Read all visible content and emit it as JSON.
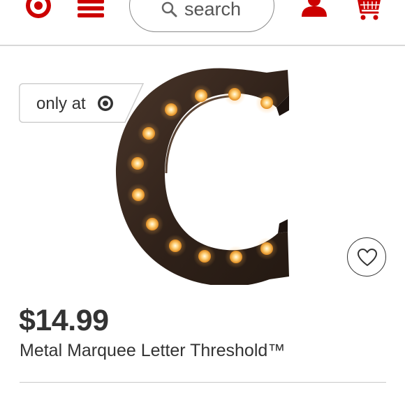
{
  "header": {
    "search": {
      "placeholder": "search"
    },
    "icons": {
      "logo": "target-bullseye-icon",
      "menu": "hamburger-menu-icon",
      "search": "magnifier-icon",
      "account": "person-icon",
      "cart": "cart-icon"
    }
  },
  "badge": {
    "text": "only at",
    "icon": "target-bullseye-icon"
  },
  "product": {
    "image": "marquee-letter-c-image",
    "price": "$14.99",
    "title": "Metal Marquee Letter Threshold™",
    "favorite_icon": "heart-icon"
  },
  "colors": {
    "brand": "#cc0000",
    "text": "#333333",
    "divider": "#c8c8c8",
    "bulb": "#ffc766",
    "letter": "#3a2a20"
  }
}
